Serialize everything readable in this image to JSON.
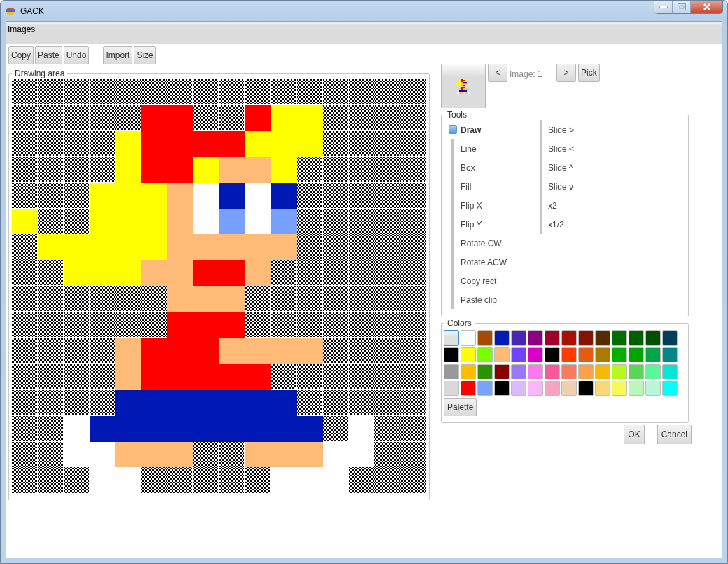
{
  "window": {
    "title": "GACK"
  },
  "menu": [
    {
      "label": "Images"
    }
  ],
  "toolbar": [
    [
      "Copy",
      "Paste",
      "Undo"
    ],
    [
      "Import",
      "Size"
    ]
  ],
  "drawing_area": {
    "title": "Drawing area",
    "pixels": [
      [
        {
          "kind": "empty"
        },
        {
          "kind": "empty"
        },
        {
          "kind": "empty"
        },
        {
          "kind": "empty"
        },
        {
          "kind": "empty"
        },
        {
          "kind": "empty"
        },
        {
          "kind": "empty"
        },
        {
          "kind": "empty"
        },
        {
          "kind": "empty"
        },
        {
          "kind": "empty"
        },
        {
          "kind": "empty"
        },
        {
          "kind": "empty"
        },
        {
          "kind": "empty"
        },
        {
          "kind": "empty"
        },
        {
          "kind": "empty"
        },
        {
          "kind": "empty"
        }
      ],
      [
        {
          "kind": "empty"
        },
        {
          "kind": "empty"
        },
        {
          "kind": "empty"
        },
        {
          "kind": "empty"
        },
        {
          "kind": "empty"
        },
        {
          "kind": "filled",
          "color": "#ff0000"
        },
        {
          "kind": "filled",
          "color": "#ff0000"
        },
        {
          "kind": "empty"
        },
        {
          "kind": "empty"
        },
        {
          "kind": "filled",
          "color": "#ff0000"
        },
        {
          "kind": "filled",
          "color": "#ffff00"
        },
        {
          "kind": "filled",
          "color": "#ffff00"
        },
        {
          "kind": "empty"
        },
        {
          "kind": "empty"
        },
        {
          "kind": "empty"
        },
        {
          "kind": "empty"
        }
      ],
      [
        {
          "kind": "empty"
        },
        {
          "kind": "empty"
        },
        {
          "kind": "empty"
        },
        {
          "kind": "empty"
        },
        {
          "kind": "filled",
          "color": "#ffff00"
        },
        {
          "kind": "filled",
          "color": "#ff0000"
        },
        {
          "kind": "filled",
          "color": "#ff0000"
        },
        {
          "kind": "filled",
          "color": "#ff0000"
        },
        {
          "kind": "filled",
          "color": "#ff0000"
        },
        {
          "kind": "filled",
          "color": "#ffff00"
        },
        {
          "kind": "filled",
          "color": "#ffff00"
        },
        {
          "kind": "filled",
          "color": "#ffff00"
        },
        {
          "kind": "empty"
        },
        {
          "kind": "empty"
        },
        {
          "kind": "empty"
        },
        {
          "kind": "empty"
        }
      ],
      [
        {
          "kind": "empty"
        },
        {
          "kind": "empty"
        },
        {
          "kind": "empty"
        },
        {
          "kind": "empty"
        },
        {
          "kind": "filled",
          "color": "#ffff00"
        },
        {
          "kind": "filled",
          "color": "#ff0000"
        },
        {
          "kind": "filled",
          "color": "#ff0000"
        },
        {
          "kind": "filled",
          "color": "#ffff00"
        },
        {
          "kind": "filled",
          "color": "#ffbb77"
        },
        {
          "kind": "filled",
          "color": "#ffbb77"
        },
        {
          "kind": "filled",
          "color": "#ffff00"
        },
        {
          "kind": "empty"
        },
        {
          "kind": "empty"
        },
        {
          "kind": "empty"
        },
        {
          "kind": "empty"
        },
        {
          "kind": "empty"
        }
      ],
      [
        {
          "kind": "empty"
        },
        {
          "kind": "empty"
        },
        {
          "kind": "empty"
        },
        {
          "kind": "filled",
          "color": "#ffff00"
        },
        {
          "kind": "filled",
          "color": "#ffff00"
        },
        {
          "kind": "filled",
          "color": "#ffff00"
        },
        {
          "kind": "filled",
          "color": "#ffbb77"
        },
        {
          "kind": "filled",
          "color": "#ffffff"
        },
        {
          "kind": "filled",
          "color": "#0019b5"
        },
        {
          "kind": "filled",
          "color": "#ffffff"
        },
        {
          "kind": "filled",
          "color": "#0019b5"
        },
        {
          "kind": "empty"
        },
        {
          "kind": "empty"
        },
        {
          "kind": "empty"
        },
        {
          "kind": "empty"
        },
        {
          "kind": "empty"
        }
      ],
      [
        {
          "kind": "filled",
          "color": "#ffff00"
        },
        {
          "kind": "empty"
        },
        {
          "kind": "empty"
        },
        {
          "kind": "filled",
          "color": "#ffff00"
        },
        {
          "kind": "filled",
          "color": "#ffff00"
        },
        {
          "kind": "filled",
          "color": "#ffff00"
        },
        {
          "kind": "filled",
          "color": "#ffbb77"
        },
        {
          "kind": "filled",
          "color": "#ffffff"
        },
        {
          "kind": "filled",
          "color": "#77a0ff"
        },
        {
          "kind": "filled",
          "color": "#ffffff"
        },
        {
          "kind": "filled",
          "color": "#77a0ff"
        },
        {
          "kind": "empty"
        },
        {
          "kind": "empty"
        },
        {
          "kind": "empty"
        },
        {
          "kind": "empty"
        },
        {
          "kind": "empty"
        }
      ],
      [
        {
          "kind": "empty"
        },
        {
          "kind": "filled",
          "color": "#ffff00"
        },
        {
          "kind": "filled",
          "color": "#ffff00"
        },
        {
          "kind": "filled",
          "color": "#ffff00"
        },
        {
          "kind": "filled",
          "color": "#ffff00"
        },
        {
          "kind": "filled",
          "color": "#ffff00"
        },
        {
          "kind": "filled",
          "color": "#ffbb77"
        },
        {
          "kind": "filled",
          "color": "#ffbb77"
        },
        {
          "kind": "filled",
          "color": "#ffbb77"
        },
        {
          "kind": "filled",
          "color": "#ffbb77"
        },
        {
          "kind": "filled",
          "color": "#ffbb77"
        },
        {
          "kind": "empty"
        },
        {
          "kind": "empty"
        },
        {
          "kind": "empty"
        },
        {
          "kind": "empty"
        },
        {
          "kind": "empty"
        }
      ],
      [
        {
          "kind": "empty"
        },
        {
          "kind": "empty"
        },
        {
          "kind": "filled",
          "color": "#ffff00"
        },
        {
          "kind": "filled",
          "color": "#ffff00"
        },
        {
          "kind": "filled",
          "color": "#ffff00"
        },
        {
          "kind": "filled",
          "color": "#ffbb77"
        },
        {
          "kind": "filled",
          "color": "#ffbb77"
        },
        {
          "kind": "filled",
          "color": "#ff0000"
        },
        {
          "kind": "filled",
          "color": "#ff0000"
        },
        {
          "kind": "filled",
          "color": "#ffbb77"
        },
        {
          "kind": "empty"
        },
        {
          "kind": "empty"
        },
        {
          "kind": "empty"
        },
        {
          "kind": "empty"
        },
        {
          "kind": "empty"
        },
        {
          "kind": "empty"
        }
      ],
      [
        {
          "kind": "empty"
        },
        {
          "kind": "empty"
        },
        {
          "kind": "empty"
        },
        {
          "kind": "empty"
        },
        {
          "kind": "empty"
        },
        {
          "kind": "empty"
        },
        {
          "kind": "filled",
          "color": "#ffbb77"
        },
        {
          "kind": "filled",
          "color": "#ffbb77"
        },
        {
          "kind": "filled",
          "color": "#ffbb77"
        },
        {
          "kind": "empty"
        },
        {
          "kind": "empty"
        },
        {
          "kind": "empty"
        },
        {
          "kind": "empty"
        },
        {
          "kind": "empty"
        },
        {
          "kind": "empty"
        },
        {
          "kind": "empty"
        }
      ],
      [
        {
          "kind": "empty"
        },
        {
          "kind": "empty"
        },
        {
          "kind": "empty"
        },
        {
          "kind": "empty"
        },
        {
          "kind": "empty"
        },
        {
          "kind": "empty"
        },
        {
          "kind": "filled",
          "color": "#ff0000"
        },
        {
          "kind": "filled",
          "color": "#ff0000"
        },
        {
          "kind": "filled",
          "color": "#ff0000"
        },
        {
          "kind": "empty"
        },
        {
          "kind": "empty"
        },
        {
          "kind": "empty"
        },
        {
          "kind": "empty"
        },
        {
          "kind": "empty"
        },
        {
          "kind": "empty"
        },
        {
          "kind": "empty"
        }
      ],
      [
        {
          "kind": "empty"
        },
        {
          "kind": "empty"
        },
        {
          "kind": "empty"
        },
        {
          "kind": "empty"
        },
        {
          "kind": "filled",
          "color": "#ffbb77"
        },
        {
          "kind": "filled",
          "color": "#ff0000"
        },
        {
          "kind": "filled",
          "color": "#ff0000"
        },
        {
          "kind": "filled",
          "color": "#ff0000"
        },
        {
          "kind": "filled",
          "color": "#ffbb77"
        },
        {
          "kind": "filled",
          "color": "#ffbb77"
        },
        {
          "kind": "filled",
          "color": "#ffbb77"
        },
        {
          "kind": "filled",
          "color": "#ffbb77"
        },
        {
          "kind": "empty"
        },
        {
          "kind": "empty"
        },
        {
          "kind": "empty"
        },
        {
          "kind": "empty"
        }
      ],
      [
        {
          "kind": "empty"
        },
        {
          "kind": "empty"
        },
        {
          "kind": "empty"
        },
        {
          "kind": "empty"
        },
        {
          "kind": "filled",
          "color": "#ffbb77"
        },
        {
          "kind": "filled",
          "color": "#ff0000"
        },
        {
          "kind": "filled",
          "color": "#ff0000"
        },
        {
          "kind": "filled",
          "color": "#ff0000"
        },
        {
          "kind": "filled",
          "color": "#ff0000"
        },
        {
          "kind": "filled",
          "color": "#ff0000"
        },
        {
          "kind": "empty"
        },
        {
          "kind": "empty"
        },
        {
          "kind": "empty"
        },
        {
          "kind": "empty"
        },
        {
          "kind": "empty"
        },
        {
          "kind": "empty"
        }
      ],
      [
        {
          "kind": "empty"
        },
        {
          "kind": "empty"
        },
        {
          "kind": "empty"
        },
        {
          "kind": "empty"
        },
        {
          "kind": "filled",
          "color": "#0019b5"
        },
        {
          "kind": "filled",
          "color": "#0019b5"
        },
        {
          "kind": "filled",
          "color": "#0019b5"
        },
        {
          "kind": "filled",
          "color": "#0019b5"
        },
        {
          "kind": "filled",
          "color": "#0019b5"
        },
        {
          "kind": "filled",
          "color": "#0019b5"
        },
        {
          "kind": "filled",
          "color": "#0019b5"
        },
        {
          "kind": "empty"
        },
        {
          "kind": "empty"
        },
        {
          "kind": "empty"
        },
        {
          "kind": "empty"
        },
        {
          "kind": "empty"
        }
      ],
      [
        {
          "kind": "empty"
        },
        {
          "kind": "empty"
        },
        {
          "kind": "filled",
          "color": "#ffffff"
        },
        {
          "kind": "filled",
          "color": "#0019b5"
        },
        {
          "kind": "filled",
          "color": "#0019b5"
        },
        {
          "kind": "filled",
          "color": "#0019b5"
        },
        {
          "kind": "filled",
          "color": "#0019b5"
        },
        {
          "kind": "filled",
          "color": "#0019b5"
        },
        {
          "kind": "filled",
          "color": "#0019b5"
        },
        {
          "kind": "filled",
          "color": "#0019b5"
        },
        {
          "kind": "filled",
          "color": "#0019b5"
        },
        {
          "kind": "filled",
          "color": "#0019b5"
        },
        {
          "kind": "empty"
        },
        {
          "kind": "filled",
          "color": "#ffffff"
        },
        {
          "kind": "empty"
        },
        {
          "kind": "empty"
        }
      ],
      [
        {
          "kind": "empty"
        },
        {
          "kind": "empty"
        },
        {
          "kind": "filled",
          "color": "#ffffff"
        },
        {
          "kind": "filled",
          "color": "#ffffff"
        },
        {
          "kind": "filled",
          "color": "#ffbb77"
        },
        {
          "kind": "filled",
          "color": "#ffbb77"
        },
        {
          "kind": "filled",
          "color": "#ffbb77"
        },
        {
          "kind": "empty"
        },
        {
          "kind": "empty"
        },
        {
          "kind": "filled",
          "color": "#ffbb77"
        },
        {
          "kind": "filled",
          "color": "#ffbb77"
        },
        {
          "kind": "filled",
          "color": "#ffbb77"
        },
        {
          "kind": "filled",
          "color": "#ffffff"
        },
        {
          "kind": "filled",
          "color": "#ffffff"
        },
        {
          "kind": "empty"
        },
        {
          "kind": "empty"
        }
      ],
      [
        {
          "kind": "empty"
        },
        {
          "kind": "empty"
        },
        {
          "kind": "empty"
        },
        {
          "kind": "filled",
          "color": "#ffffff"
        },
        {
          "kind": "filled",
          "color": "#ffffff"
        },
        {
          "kind": "empty"
        },
        {
          "kind": "empty"
        },
        {
          "kind": "empty"
        },
        {
          "kind": "empty"
        },
        {
          "kind": "empty"
        },
        {
          "kind": "filled",
          "color": "#ffffff"
        },
        {
          "kind": "filled",
          "color": "#ffffff"
        },
        {
          "kind": "filled",
          "color": "#ffffff"
        },
        {
          "kind": "empty"
        },
        {
          "kind": "empty"
        },
        {
          "kind": "empty"
        }
      ]
    ]
  },
  "image_nav": {
    "prev": "<",
    "label": "Image: 1",
    "next": ">",
    "pick": "Pick"
  },
  "tools": {
    "title": "Tools",
    "modes": [
      {
        "label": "Draw",
        "selected": true
      },
      {
        "label": "Line",
        "selected": false
      },
      {
        "label": "Box",
        "selected": false
      },
      {
        "label": "Fill",
        "selected": false
      },
      {
        "label": "Flip X",
        "selected": false
      },
      {
        "label": "Flip Y",
        "selected": false
      },
      {
        "label": "Rotate CW",
        "selected": false
      },
      {
        "label": "Rotate ACW",
        "selected": false
      },
      {
        "label": "Copy rect",
        "selected": false
      },
      {
        "label": "Paste clip",
        "selected": false
      }
    ],
    "actions": [
      "Slide >",
      "Slide <",
      "Slide ^",
      "Slide v",
      "x2",
      "x1/2"
    ]
  },
  "colors": {
    "title": "Colors",
    "swatches": [
      {
        "color": "#e0e0e0",
        "selected": true
      },
      {
        "color": "#ffffff",
        "selected": false
      },
      {
        "color": "#a64b00",
        "selected": false
      },
      {
        "color": "#001cb5",
        "selected": false
      },
      {
        "color": "#4628b5",
        "selected": false
      },
      {
        "color": "#8c0080",
        "selected": false
      },
      {
        "color": "#a0002a",
        "selected": false
      },
      {
        "color": "#a61100",
        "selected": false
      },
      {
        "color": "#881300",
        "selected": false
      },
      {
        "color": "#532d00",
        "selected": false
      },
      {
        "color": "#006e00",
        "selected": false
      },
      {
        "color": "#006000",
        "selected": false
      },
      {
        "color": "#004f00",
        "selected": false
      },
      {
        "color": "#003f5a",
        "selected": false
      },
      {
        "color": "#000000",
        "selected": false
      },
      {
        "color": "#ffff00",
        "selected": false
      },
      {
        "color": "#78ff00",
        "selected": false
      },
      {
        "color": "#ffbb77",
        "selected": false
      },
      {
        "color": "#6e44ff",
        "selected": false
      },
      {
        "color": "#d600c6",
        "selected": false
      },
      {
        "color": "#000000",
        "selected": false
      },
      {
        "color": "#ff3b00",
        "selected": false
      },
      {
        "color": "#e55b13",
        "selected": false
      },
      {
        "color": "#ab7800",
        "selected": false
      },
      {
        "color": "#00b000",
        "selected": false
      },
      {
        "color": "#00a500",
        "selected": false
      },
      {
        "color": "#00a548",
        "selected": false
      },
      {
        "color": "#008888",
        "selected": false
      },
      {
        "color": "#999999",
        "selected": false
      },
      {
        "color": "#ffbd00",
        "selected": false
      },
      {
        "color": "#2b9200",
        "selected": false
      },
      {
        "color": "#890000",
        "selected": false
      },
      {
        "color": "#9a79f6",
        "selected": false
      },
      {
        "color": "#f87cf0",
        "selected": false
      },
      {
        "color": "#f65a98",
        "selected": false
      },
      {
        "color": "#f77c5f",
        "selected": false
      },
      {
        "color": "#f9a24a",
        "selected": false
      },
      {
        "color": "#f9b900",
        "selected": false
      },
      {
        "color": "#b8f818",
        "selected": false
      },
      {
        "color": "#58d854",
        "selected": false
      },
      {
        "color": "#58f898",
        "selected": false
      },
      {
        "color": "#00e8d8",
        "selected": false
      },
      {
        "color": "#d9d9d9",
        "selected": false
      },
      {
        "color": "#ff0000",
        "selected": false
      },
      {
        "color": "#7aa2ff",
        "selected": false
      },
      {
        "color": "#000000",
        "selected": false
      },
      {
        "color": "#d7bcf8",
        "selected": false
      },
      {
        "color": "#f8b8f8",
        "selected": false
      },
      {
        "color": "#f8a4c0",
        "selected": false
      },
      {
        "color": "#f0d0b0",
        "selected": false
      },
      {
        "color": "#000000",
        "selected": false
      },
      {
        "color": "#f8d878",
        "selected": false
      },
      {
        "color": "#f8f858",
        "selected": false
      },
      {
        "color": "#b8f8b8",
        "selected": false
      },
      {
        "color": "#b8f8d8",
        "selected": false
      },
      {
        "color": "#00ffff",
        "selected": false
      }
    ],
    "palette_button": "Palette"
  },
  "buttons": [
    "OK",
    "Cancel"
  ]
}
